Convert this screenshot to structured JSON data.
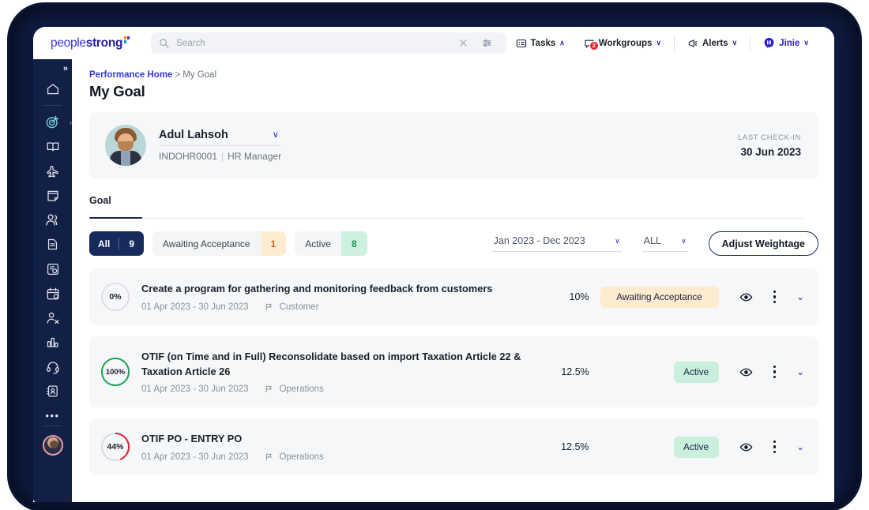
{
  "brand": {
    "logo_light": "people",
    "logo_bold": "strong"
  },
  "search": {
    "placeholder": "Search",
    "value": "",
    "clear_icon": "close-icon",
    "filter_icon": "sliders-icon"
  },
  "topnav": {
    "items": [
      {
        "label": "Tasks",
        "icon": "tasks-icon",
        "chevron": "∧",
        "badge": ""
      },
      {
        "label": "Workgroups",
        "icon": "workgroups-icon",
        "chevron": "∨",
        "badge": "2"
      },
      {
        "label": "Alerts",
        "icon": "megaphone-icon",
        "chevron": "∨",
        "badge": ""
      },
      {
        "label": "Jinie",
        "icon": "jinie-bubble-icon",
        "chevron": "∨",
        "badge": ""
      }
    ]
  },
  "sidebar": {
    "expander": "»",
    "items": [
      {
        "icon": "home-icon"
      },
      {
        "icon": "target-goal-icon"
      },
      {
        "icon": "book-icon"
      },
      {
        "icon": "plane-icon"
      },
      {
        "icon": "notes-icon"
      },
      {
        "icon": "people-icon"
      },
      {
        "icon": "document-icon"
      },
      {
        "icon": "file-settings-icon"
      },
      {
        "icon": "calendar-clock-icon"
      },
      {
        "icon": "person-remove-icon"
      },
      {
        "icon": "bar-chart-icon"
      },
      {
        "icon": "headset-icon"
      },
      {
        "icon": "contact-book-icon"
      }
    ],
    "more": "•••",
    "avatar": "user-avatar"
  },
  "breadcrumb": {
    "parent": "Performance Home",
    "separator": ">",
    "current": "My Goal"
  },
  "page_title": "My Goal",
  "profile": {
    "name": "Adul Lahsoh",
    "employee_id": "INDOHR0001",
    "pipe": "|",
    "role": "HR Manager",
    "chevron": "∨",
    "checkin_label": "LAST CHECK-IN",
    "checkin_date": "30 Jun 2023"
  },
  "tabs": [
    {
      "label": "Goal",
      "active": true
    }
  ],
  "filters": {
    "chips": [
      {
        "label": "All",
        "count": "9",
        "state": "all"
      },
      {
        "label": "Awaiting Acceptance",
        "count": "1",
        "state": "warn"
      },
      {
        "label": "Active",
        "count": "8",
        "state": "ok"
      }
    ],
    "date_range": "Jan 2023 - Dec 2023",
    "date_chevron": "∨",
    "status_filter": "ALL",
    "status_chevron": "∨",
    "adjust_weightage": "Adjust Weightage"
  },
  "goals": [
    {
      "progress": "0%",
      "progress_value": 0,
      "progress_color": "#d9dbe1",
      "title": "Create a program for gathering and monitoring feedback from customers",
      "dates": "01 Apr 2023 - 30 Jun 2023",
      "category": "Customer",
      "weight": "10%",
      "status": "Awaiting Acceptance",
      "status_kind": "wait"
    },
    {
      "progress": "100%",
      "progress_value": 100,
      "progress_color": "#16a34a",
      "title": "OTIF (on Time and in Full) Reconsolidate based on import Taxation Article 22 & Taxation Article 26",
      "dates": "01 Apr 2023 - 30 Jun 2023",
      "category": "Operations",
      "weight": "12.5%",
      "status": "Active",
      "status_kind": "act"
    },
    {
      "progress": "44%",
      "progress_value": 44,
      "progress_color": "#e11d2f",
      "title": "OTIF PO - ENTRY PO",
      "dates": "01 Apr 2023 - 30 Jun 2023",
      "category": "Operations",
      "weight": "12.5%",
      "status": "Active",
      "status_kind": "act"
    }
  ],
  "row_actions": {
    "view_icon": "eye-icon",
    "menu_icon": "kebab-menu-icon",
    "expand_icon": "chevron-down-icon"
  },
  "colors": {
    "rail": "#122046",
    "accent": "#2b21c9",
    "card": "#f6f7f9",
    "active_green": "#16a34a",
    "alert_red": "#e11d2f"
  }
}
